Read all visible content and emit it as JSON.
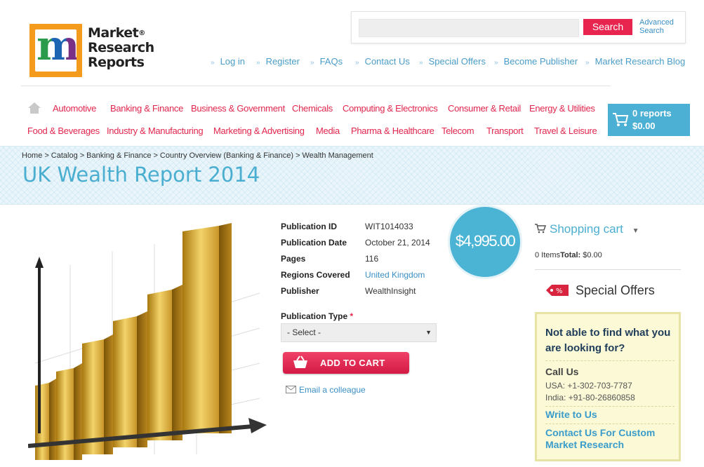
{
  "header": {
    "logo_lines": [
      "Market",
      "Research",
      "Reports"
    ],
    "logo_reg": "®",
    "search_placeholder": "",
    "search_button": "Search",
    "advanced_search": [
      "Advanced",
      "Search"
    ],
    "top_links": [
      "Log in",
      "Register",
      "FAQs",
      "Contact Us",
      "Special Offers",
      "Become Publisher",
      "Market Research Blog"
    ]
  },
  "categories": {
    "row1": [
      "Automotive",
      "Banking & Finance",
      "Business & Government",
      "Chemicals",
      "Computing & Electronics",
      "Consumer & Retail",
      "Energy & Utilities"
    ],
    "row2": [
      "Food & Beverages",
      "Industry & Manufacturing",
      "Marketing & Advertising",
      "Media",
      "Pharma & Healthcare",
      "Telecom",
      "Transport",
      "Travel & Leisure"
    ]
  },
  "cart": {
    "reports": "0 reports",
    "total": "$0.00"
  },
  "breadcrumb": [
    "Home",
    "Catalog",
    "Banking & Finance",
    "Country Overview (Banking & Finance)",
    "Wealth Management"
  ],
  "breadcrumb_sep": ">",
  "page_title": "UK Wealth Report 2014",
  "product": {
    "details": [
      {
        "label": "Publication ID",
        "value": "WIT1014033"
      },
      {
        "label": "Publication Date",
        "value": "October 21, 2014"
      },
      {
        "label": "Pages",
        "value": "116"
      },
      {
        "label": "Regions Covered",
        "value": "United Kingdom"
      },
      {
        "label": "Publisher",
        "value": "WealthInsight"
      }
    ],
    "price": "$4,995.00",
    "publication_type_label": "Publication Type",
    "required_mark": "*",
    "select_value": "- Select -",
    "add_to_cart": "ADD TO CART",
    "email_colleague": "Email a colleague"
  },
  "sidebar": {
    "shopping_cart_title": "Shopping cart",
    "items_label": "0 Items",
    "total_label": "Total:",
    "total_value": "$0.00",
    "special_offers": "Special Offers",
    "help": {
      "heading": "Not able to find what you are looking for?",
      "call_us": "Call Us",
      "phone_usa": "USA: +1-302-703-7787",
      "phone_india": "India: +91-80-26860858",
      "write_to_us": "Write to Us",
      "contact_custom": "Contact Us For Custom Market Research"
    }
  },
  "colors": {
    "accent_pink": "#e2264d",
    "accent_blue": "#4bb0d3",
    "link_blue": "#3a8fc4"
  }
}
